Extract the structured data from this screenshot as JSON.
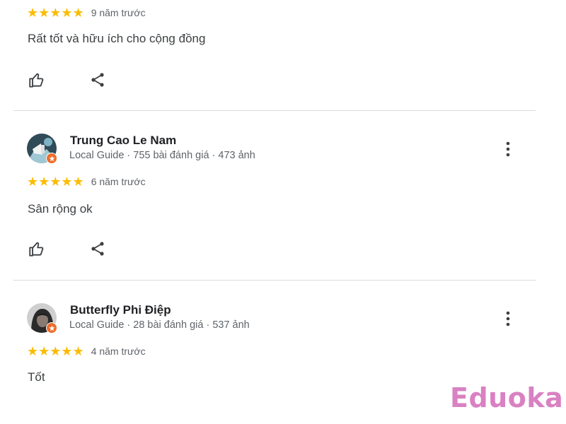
{
  "reviews": [
    {
      "stars": "★★★★★",
      "rating": 5,
      "time": "9 năm trước",
      "text": "Rất tốt và hữu ích cho cộng đồng"
    },
    {
      "author": "Trung Cao Le Nam",
      "meta": "Local Guide · 755 bài đánh giá · 473 ảnh",
      "stars": "★★★★★",
      "rating": 5,
      "time": "6 năm trước",
      "text": "Sân rộng ok"
    },
    {
      "author": "Butterfly Phi Điệp",
      "meta": "Local Guide · 28 bài đánh giá · 537 ảnh",
      "stars": "★★★★★",
      "rating": 5,
      "time": "4 năm trước",
      "text": "Tốt"
    }
  ],
  "watermark": "Eduoka",
  "icons": {
    "like": "thumbs-up-icon",
    "share": "share-icon",
    "more": "more-vertical-icon",
    "badge": "local-guide-badge-icon",
    "star": "star-icon"
  },
  "colors": {
    "star": "#fbbc04",
    "badge": "#ef6c2a",
    "watermark": "#d981c2",
    "divider": "#dadce0",
    "meta_text": "#5f6368"
  }
}
